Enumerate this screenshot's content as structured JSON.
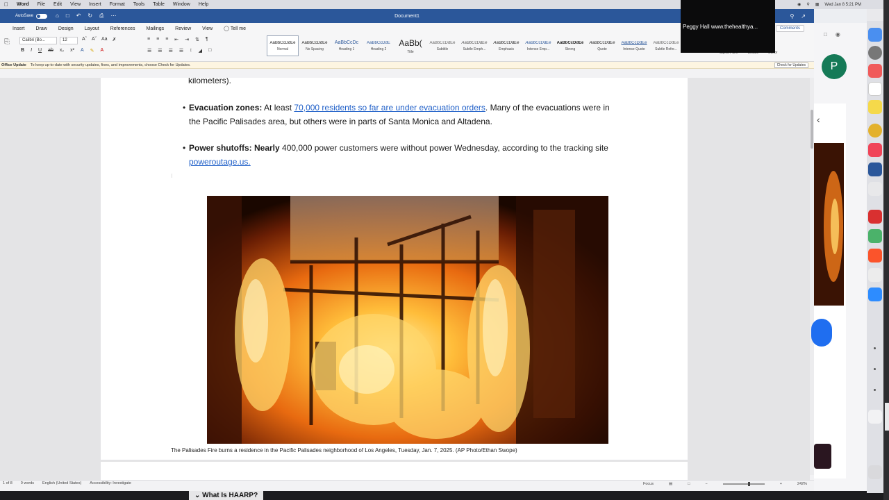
{
  "menubar": {
    "items": [
      "Word",
      "File",
      "Edit",
      "View",
      "Insert",
      "Format",
      "Tools",
      "Table",
      "Window",
      "Help"
    ],
    "clock": "Wed Jan 8  5:21 PM"
  },
  "window": {
    "autosave_label": "AutoSave",
    "doc_title": "Document1"
  },
  "ribbon": {
    "tabs": [
      "Insert",
      "Draw",
      "Design",
      "Layout",
      "References",
      "Mailings",
      "Review",
      "View"
    ],
    "tell_me": "Tell me",
    "comments_label": "Comments",
    "font_name": "Calibri (Bo...",
    "font_size": "12",
    "styles": [
      {
        "preview": "AaBbCcDdEe",
        "name": "Normal"
      },
      {
        "preview": "AaBbCcDdEe",
        "name": "No Spacing"
      },
      {
        "preview": "AaBbCcDc",
        "name": "Heading 1"
      },
      {
        "preview": "AaBbCcDdE",
        "name": "Heading 2"
      },
      {
        "preview": "AaBb(",
        "name": "Title"
      },
      {
        "preview": "AaBbCcDdEe",
        "name": "Subtitle"
      },
      {
        "preview": "AaBbCcDdEe",
        "name": "Subtle Emph..."
      },
      {
        "preview": "AaBbCcDdEe",
        "name": "Emphasis"
      },
      {
        "preview": "AaBbCcDdEe",
        "name": "Intense Emp..."
      },
      {
        "preview": "AaBbCcDdEe",
        "name": "Strong"
      },
      {
        "preview": "AaBbCcDdEe",
        "name": "Quote"
      },
      {
        "preview": "AaBbCcDdEe",
        "name": "Intense Quote"
      },
      {
        "preview": "AaBbCcDdEe",
        "name": "Subtle Refer..."
      }
    ],
    "right_labels": [
      "Styles Pane",
      "Dictate",
      "Editor"
    ]
  },
  "update_bar": {
    "title": "Office Update",
    "message": "To keep up-to-date with security updates, fixes, and improvements, choose Check for Updates.",
    "button": "Check for Updates"
  },
  "document": {
    "fragment": "kilometers).",
    "bullets": [
      {
        "label": "Evacuation zones:",
        "pre": "At least ",
        "link": "70,000 residents so far are under evacuation orders",
        "post": ". Many of the evacuations were in the Pacific Palisades area, but others were in parts of Santa Monica and Altadena."
      },
      {
        "label": "Power shutoffs: Nearly",
        "pre": " 400,000 power customers were without power Wednesday, according to the tracking site ",
        "link": "poweroutage.us.",
        "post": ""
      }
    ],
    "caption": "The Palisades Fire burns a residence in the Pacific Palisades neighborhood of Los Angeles, Tuesday, Jan. 7, 2025. (AP Photo/Ethan Swope)",
    "next_heading": "What Is HAARP?"
  },
  "status": {
    "page": "1 of 8",
    "words": "0 words",
    "language": "English (United States)",
    "accessibility": "Accessibility: Investigate",
    "focus": "Focus",
    "zoom": "242%"
  },
  "video_overlay": {
    "name": "Peggy Hall www.thehealthya..."
  },
  "browser": {
    "avatar_letter": "P"
  },
  "colors": {
    "word_blue": "#2b579a",
    "link_blue": "#1f5fc8",
    "avatar_green": "#157a57"
  }
}
